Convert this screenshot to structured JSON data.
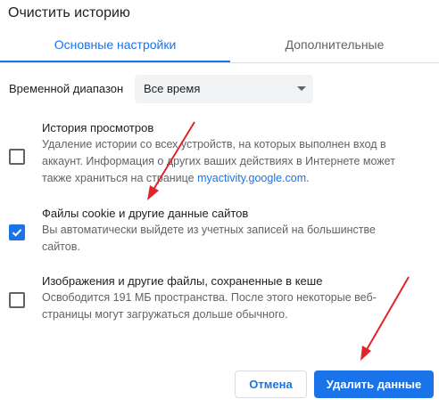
{
  "dialog": {
    "title": "Очистить историю"
  },
  "tabs": [
    {
      "label": "Основные настройки",
      "active": true
    },
    {
      "label": "Дополнительные",
      "active": false
    }
  ],
  "time_range": {
    "label": "Временной диапазон",
    "selected": "Все время"
  },
  "options": {
    "history": {
      "title": "История просмотров",
      "checked": false,
      "desc_line1": "Удаление истории со всех устройств, на которых выполнен вход в",
      "desc_line2": "аккаунт. Информация о других ваших действиях в Интернете может",
      "desc_line3_prefix": "также храниться на странице ",
      "desc_link": "myactivity.google.com",
      "desc_line3_suffix": "."
    },
    "cookies": {
      "title": "Файлы cookie и другие данные сайтов",
      "checked": true,
      "desc_line1": "Вы автоматически выйдете из учетных записей на большинстве",
      "desc_line2": "сайтов."
    },
    "cache": {
      "title": "Изображения и другие файлы, сохраненные в кеше",
      "checked": false,
      "desc_line1": "Освободится 191 МБ пространства. После этого некоторые веб-",
      "desc_line2": "страницы могут загружаться дольше обычного."
    }
  },
  "buttons": {
    "cancel": "Отмена",
    "delete": "Удалить данные"
  },
  "colors": {
    "accent": "#1a73e8",
    "annotation_arrow": "#e0252a"
  }
}
